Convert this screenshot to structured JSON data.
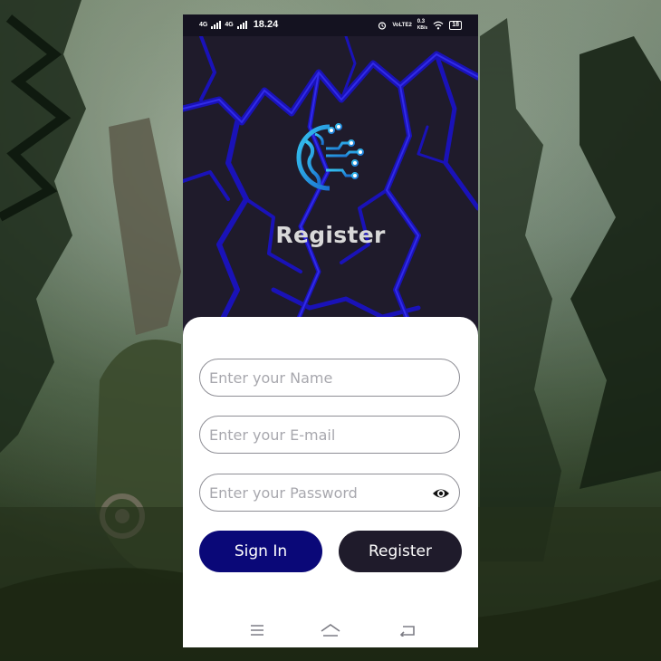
{
  "status_bar": {
    "net1": "4G",
    "net2": "4G",
    "time": "18.24",
    "volte": "VoLTE2",
    "speed": "0.3",
    "speed_unit": "KB/s",
    "battery": "18"
  },
  "hero": {
    "title": "Register",
    "logo_icon": "globe-circuit-icon",
    "background": "lightning"
  },
  "form": {
    "name_placeholder": "Enter your Name",
    "name_value": "",
    "email_placeholder": "Enter your E-mail",
    "email_value": "",
    "password_placeholder": "Enter your Password",
    "password_value": "",
    "password_toggle_icon": "eye-icon"
  },
  "buttons": {
    "signin_label": "Sign In",
    "register_label": "Register"
  },
  "nav_bar": {
    "icons": [
      "menu-icon",
      "home-icon",
      "back-icon"
    ]
  },
  "colors": {
    "header_bg": "#1f1b2b",
    "signin_bg": "#0a0878",
    "register_bg": "#1f1b2b",
    "lightning": "#1a12c8",
    "logo_accent": "#2aa8e0"
  }
}
